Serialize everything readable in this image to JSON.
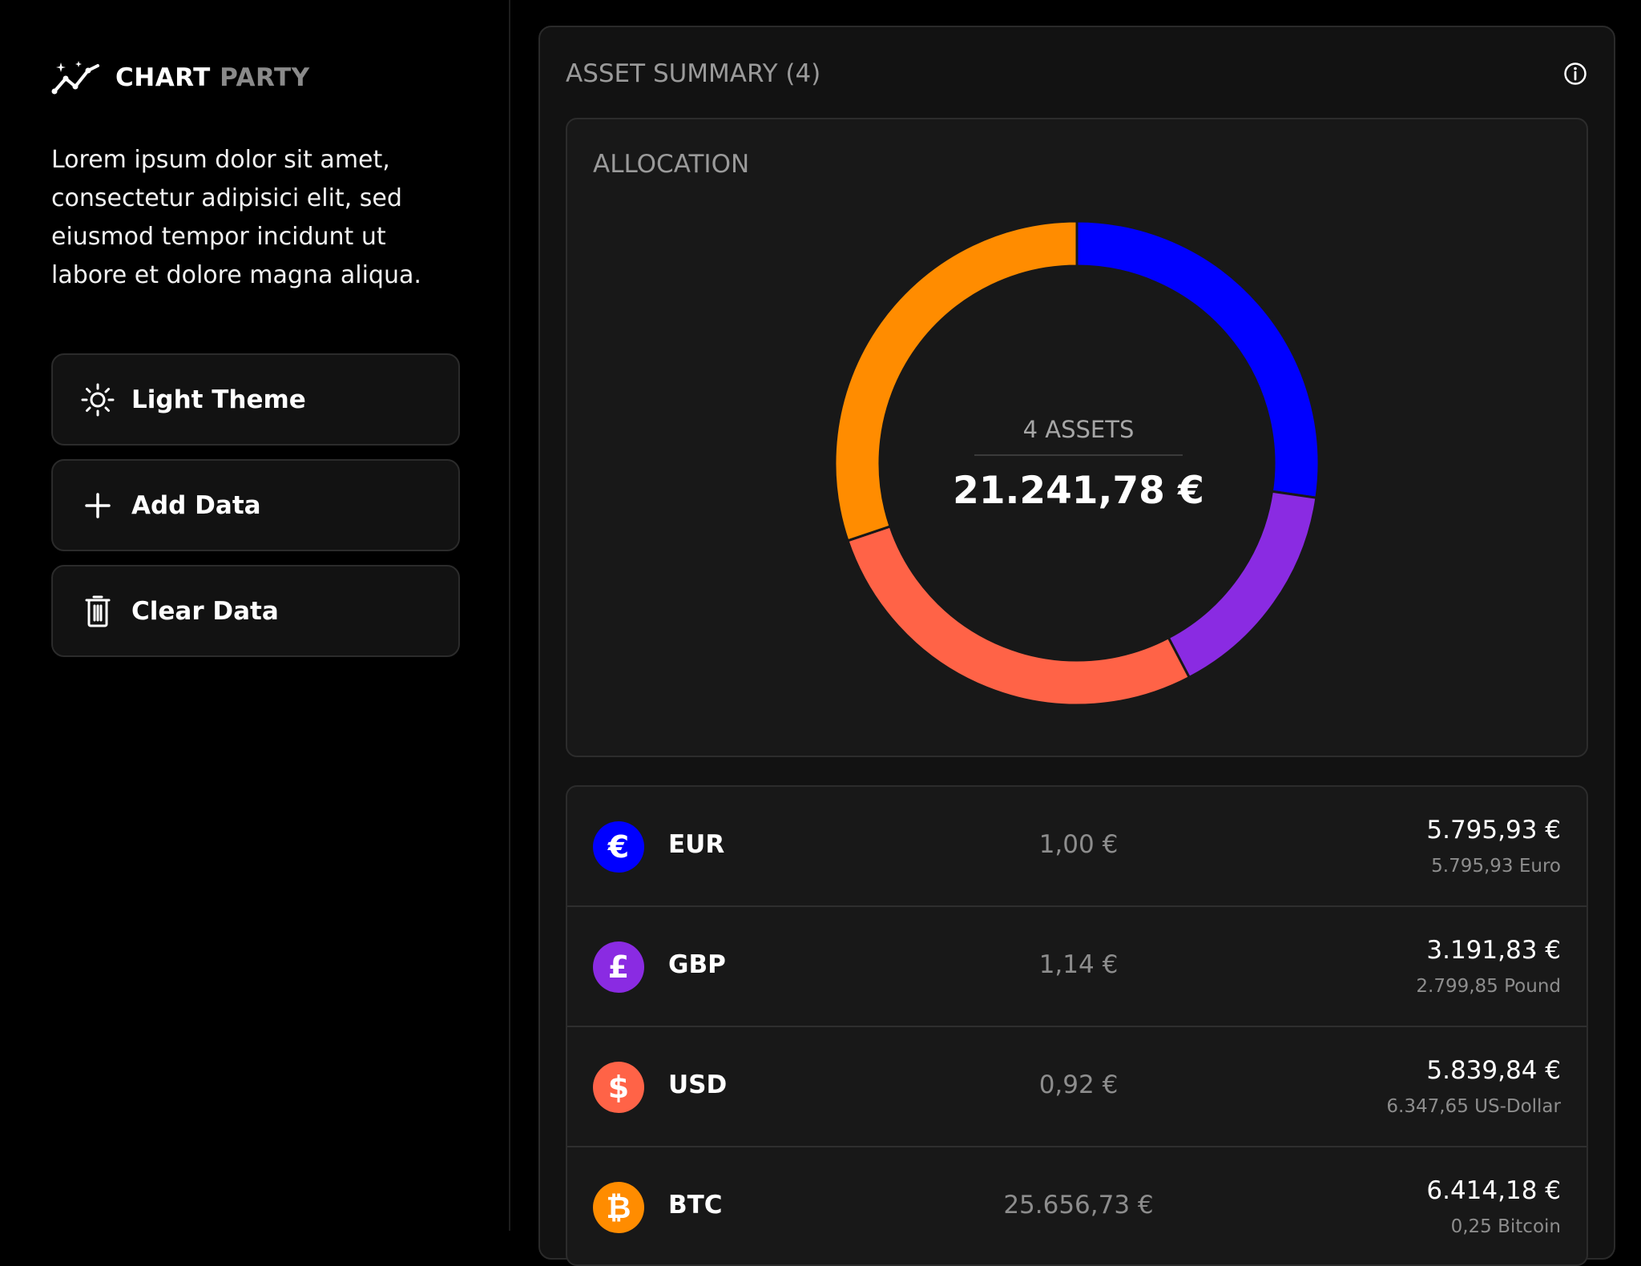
{
  "brand": {
    "word1": "CHART",
    "word2": "PARTY",
    "icon": "sparkle-chart-icon"
  },
  "intro": "Lorem ipsum dolor sit amet, consectetur adipisici elit, sed eiusmod tempor incidunt ut labore et dolore magna aliqua.",
  "buttons": [
    {
      "label": "Light Theme",
      "icon": "sun-icon"
    },
    {
      "label": "Add Data",
      "icon": "plus-icon"
    },
    {
      "label": "Clear Data",
      "icon": "trash-icon"
    }
  ],
  "summary": {
    "title": "ASSET SUMMARY (4)",
    "info_icon": "info-icon"
  },
  "allocation": {
    "title": "ALLOCATION",
    "center_label": "4 ASSETS",
    "total": "21.241,78 €"
  },
  "colors": {
    "eur": "#0000ff",
    "gbp": "#8a2be2",
    "usd": "#ff6347",
    "btc": "#ff8c00",
    "background": "#000000",
    "panel": "#121212"
  },
  "assets": [
    {
      "symbol": "€",
      "code": "EUR",
      "rate": "1,00 €",
      "value": "5.795,93 €",
      "amount": "5.795,93 Euro",
      "color": "#0000ff"
    },
    {
      "symbol": "£",
      "code": "GBP",
      "rate": "1,14 €",
      "value": "3.191,83 €",
      "amount": "2.799,85 Pound",
      "color": "#8a2be2"
    },
    {
      "symbol": "$",
      "code": "USD",
      "rate": "0,92 €",
      "value": "5.839,84 €",
      "amount": "6.347,65 US-Dollar",
      "color": "#ff6347"
    },
    {
      "symbol": "₿",
      "code": "BTC",
      "rate": "25.656,73 €",
      "value": "6.414,18 €",
      "amount": "0,25 Bitcoin",
      "color": "#ff8c00"
    }
  ],
  "chart_data": {
    "type": "pie",
    "categories": [
      "EUR",
      "GBP",
      "USD",
      "BTC"
    ],
    "values": [
      5795.93,
      3191.83,
      5839.84,
      6414.18
    ],
    "colors": [
      "#0000ff",
      "#8a2be2",
      "#ff6347",
      "#ff8c00"
    ],
    "center_label": "4 ASSETS",
    "total": "21.241,78 €"
  }
}
